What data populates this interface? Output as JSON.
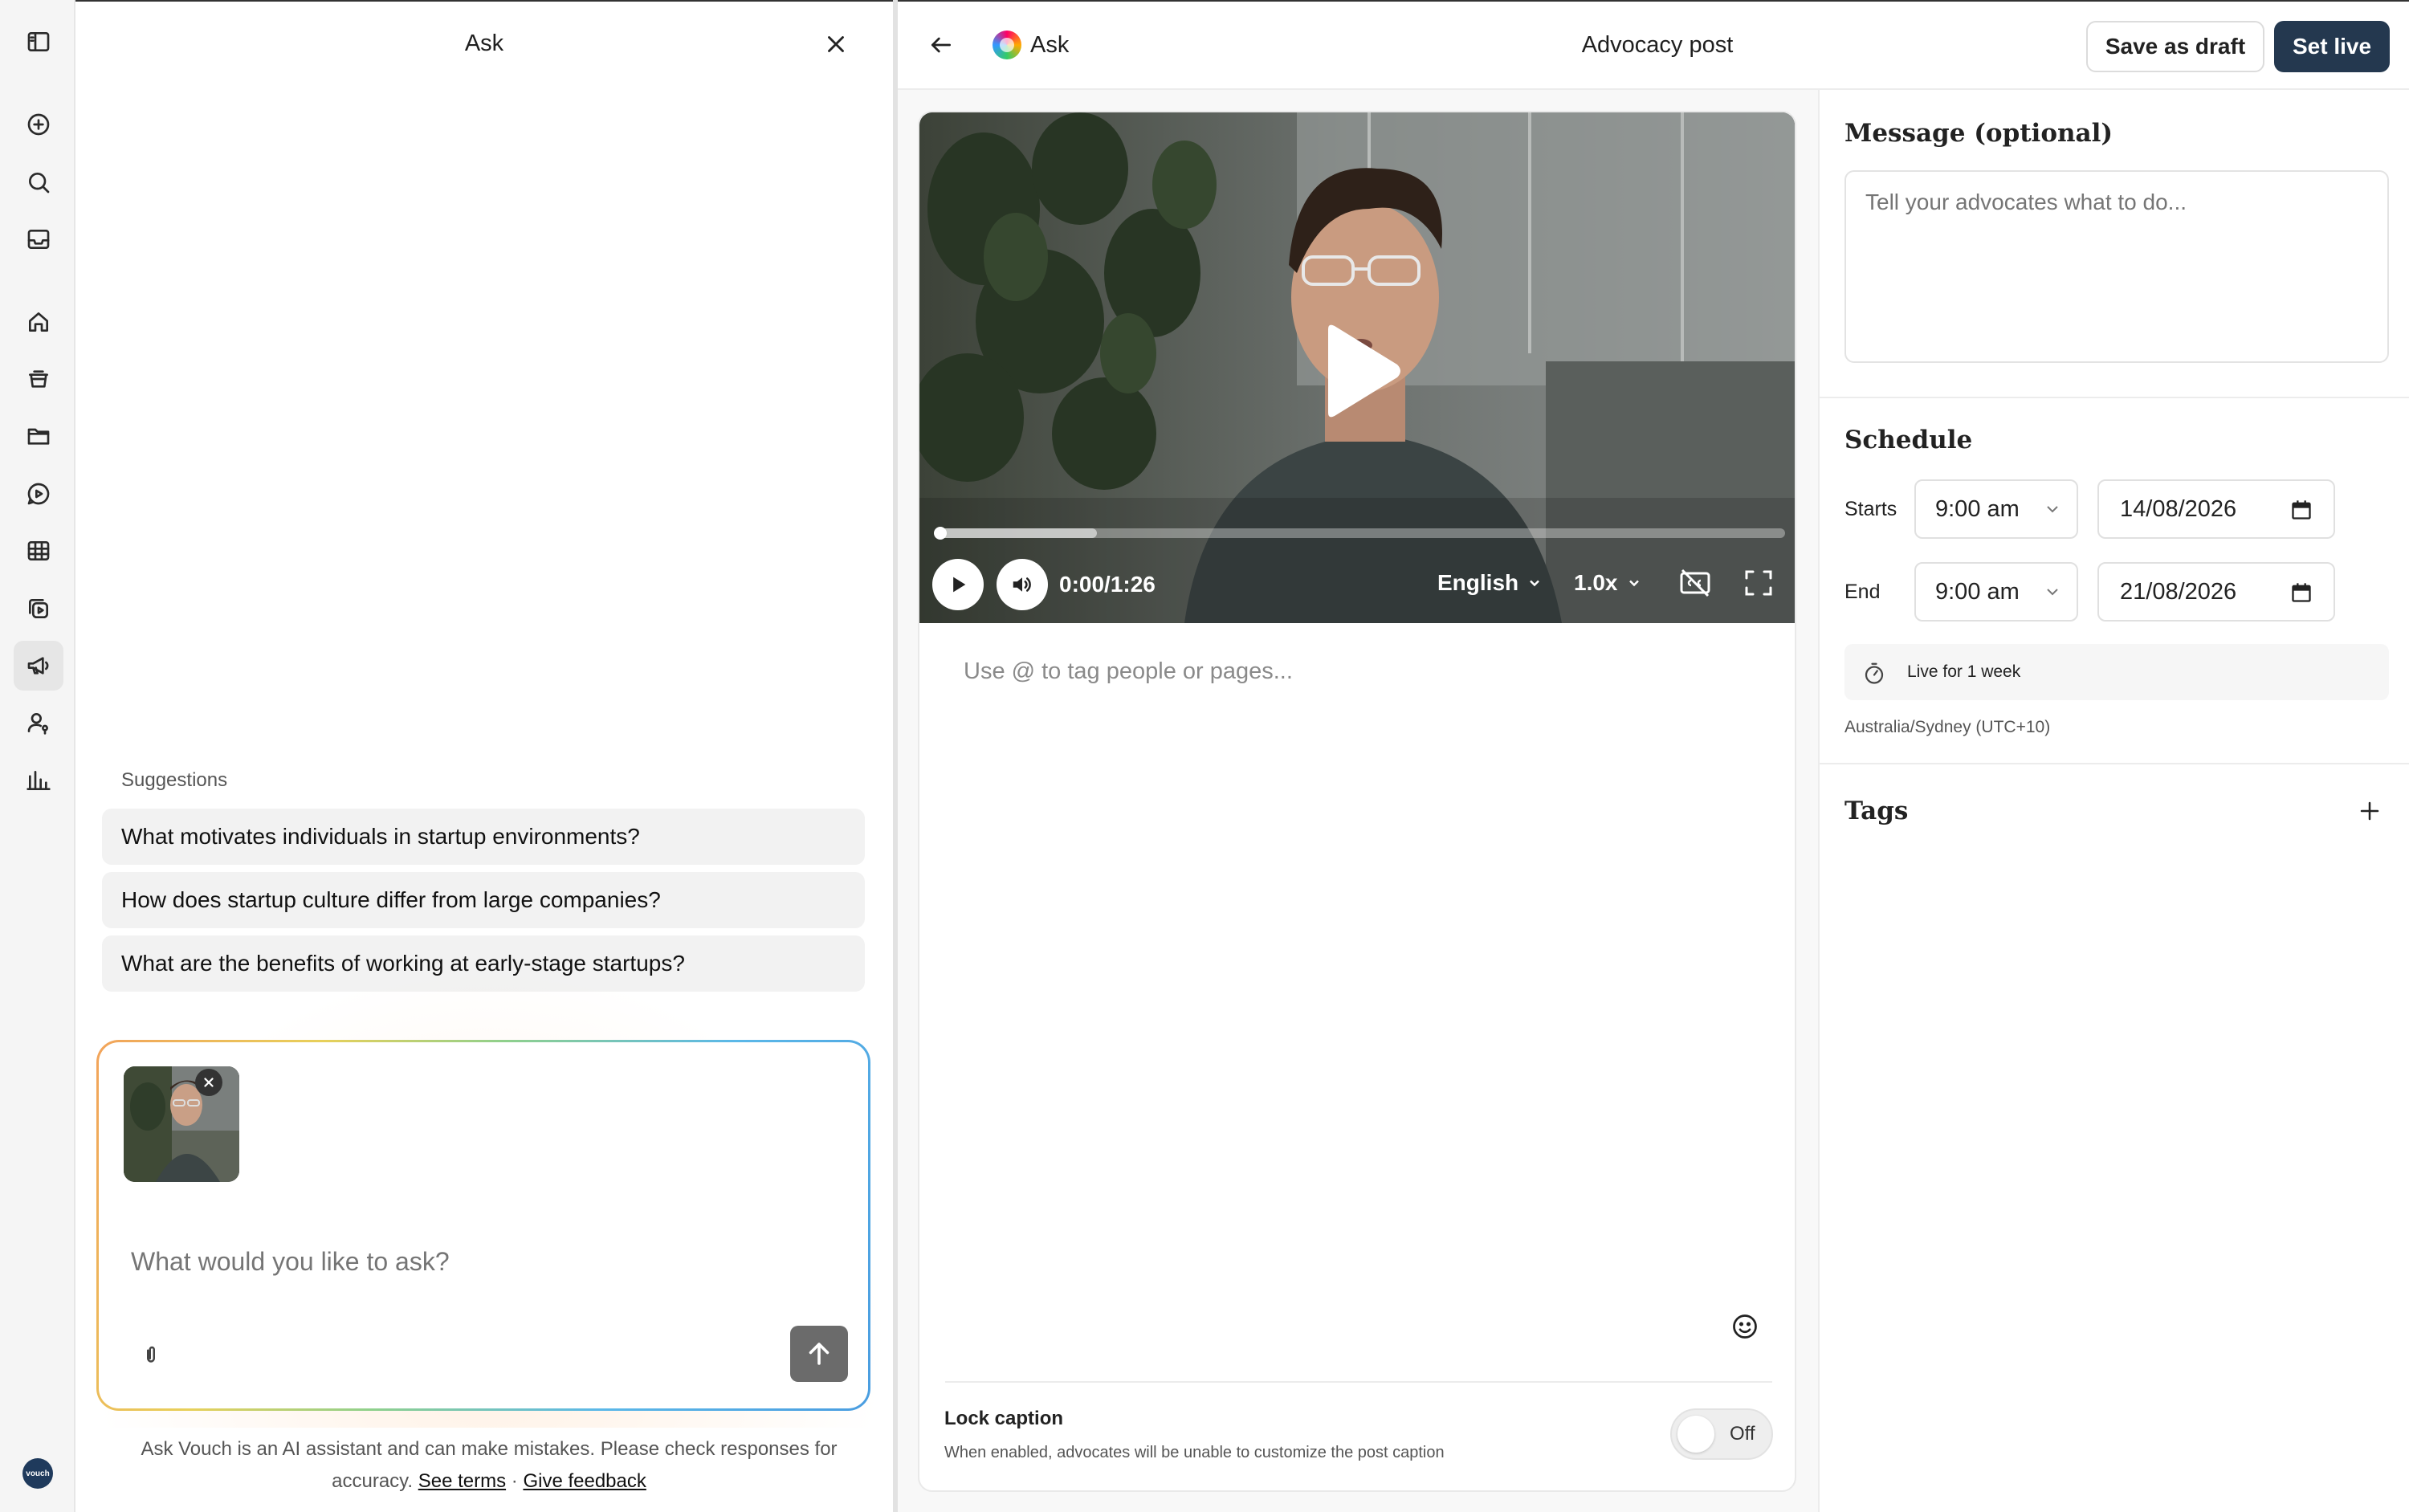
{
  "rail": {
    "items": [
      {
        "icon": "sidebar-toggle-icon"
      },
      {
        "icon": "plus-circle-icon"
      },
      {
        "icon": "search-icon"
      },
      {
        "icon": "inbox-icon"
      },
      {
        "icon": "home-icon"
      },
      {
        "icon": "basket-icon"
      },
      {
        "icon": "folder-icon"
      },
      {
        "icon": "chat-play-icon"
      },
      {
        "icon": "grid-icon"
      },
      {
        "icon": "copy-play-icon"
      },
      {
        "icon": "megaphone-icon"
      },
      {
        "icon": "user-key-icon"
      },
      {
        "icon": "bar-chart-icon"
      }
    ],
    "active": "megaphone-icon",
    "logo_text": "vouch"
  },
  "ask_panel": {
    "title": "Ask",
    "suggestions_label": "Suggestions",
    "suggestions": [
      "What motivates individuals in startup environments?",
      "How does startup culture differ from large companies?",
      "What are the benefits of working at early-stage startups?"
    ],
    "input_placeholder": "What would you like to ask?",
    "disclaimer": "Ask Vouch is an AI assistant and can make mistakes. Please check responses for accuracy.",
    "see_terms": "See terms",
    "separator": "·",
    "give_feedback": "Give feedback"
  },
  "header": {
    "ask_label": "Ask",
    "page_title": "Advocacy post",
    "save_draft": "Save as draft",
    "set_live": "Set live"
  },
  "video": {
    "time": "0:00/1:26",
    "language": "English",
    "speed": "1.0x",
    "progress_fraction": 0.0,
    "buffered_fraction": 0.19
  },
  "caption": {
    "placeholder": "Use @ to tag people or pages...",
    "lock_title": "Lock caption",
    "lock_description": "When enabled, advocates will be unable to customize the post caption",
    "lock_state": "Off"
  },
  "settings": {
    "message_title": "Message (optional)",
    "message_placeholder": "Tell your advocates what to do...",
    "schedule_title": "Schedule",
    "starts_label": "Starts",
    "starts_time": "9:00 am",
    "starts_date": "14/08/2026",
    "end_label": "End",
    "end_time": "9:00 am",
    "end_date": "21/08/2026",
    "live_duration": "Live for 1 week",
    "timezone": "Australia/Sydney (UTC+10)",
    "tags_title": "Tags"
  },
  "colors": {
    "primary": "#24384f",
    "rail_bg": "#f5f5f5",
    "suggestion_bg": "#f2f2f2"
  }
}
